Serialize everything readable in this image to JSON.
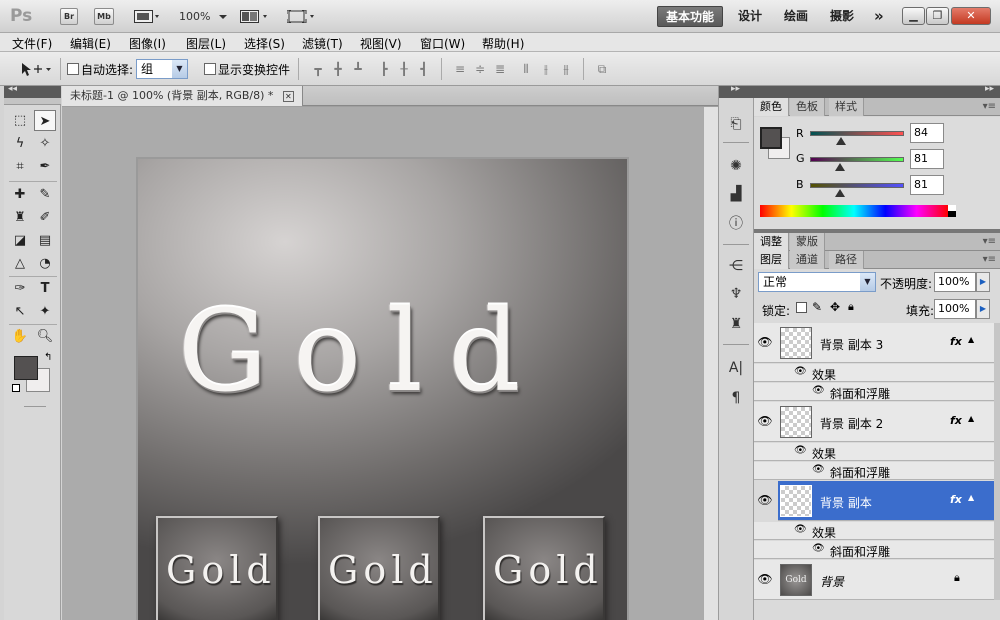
{
  "appbar": {
    "logo": "Ps",
    "bridge_label": "Br",
    "minibridge_label": "Mb",
    "zoom_value": "100%",
    "workspaces": [
      "基本功能",
      "设计",
      "绘画",
      "摄影"
    ],
    "more_label": "»"
  },
  "menu": {
    "items": [
      "文件(F)",
      "编辑(E)",
      "图像(I)",
      "图层(L)",
      "选择(S)",
      "滤镜(T)",
      "视图(V)",
      "窗口(W)",
      "帮助(H)"
    ]
  },
  "options": {
    "auto_select_label": "自动选择:",
    "auto_select_value": "组",
    "show_transform_label": "显示变换控件"
  },
  "document": {
    "tab_title": "未标题-1 @ 100% (背景 副本, RGB/8) *",
    "big_text": "Gold",
    "tile_texts": [
      "Gold",
      "Gold",
      "Gold"
    ]
  },
  "color_panel": {
    "tabs": [
      "颜色",
      "色板",
      "样式"
    ],
    "r_label": "R",
    "g_label": "G",
    "b_label": "B",
    "r_value": "84",
    "g_value": "81",
    "b_value": "81",
    "r": 84,
    "g": 81,
    "b": 81,
    "foreground": "#545151",
    "background": "#f0eeee"
  },
  "adjust_panel": {
    "tabs": [
      "调整",
      "蒙版"
    ]
  },
  "layers_panel": {
    "tabs": [
      "图层",
      "通道",
      "路径"
    ],
    "blend_mode": "正常",
    "opacity_label": "不透明度:",
    "opacity_value": "100%",
    "lock_label": "锁定:",
    "fill_label": "填充:",
    "fill_value": "100%",
    "fx_label": "fx",
    "effects_label": "效果",
    "bevel_label": "斜面和浮雕",
    "layers": [
      {
        "name": "背景 副本 3"
      },
      {
        "name": "背景 副本 2"
      },
      {
        "name": "背景 副本"
      },
      {
        "name": "背景",
        "thumb_text": "Gold"
      }
    ]
  },
  "accent_color": "#3b6dcc"
}
